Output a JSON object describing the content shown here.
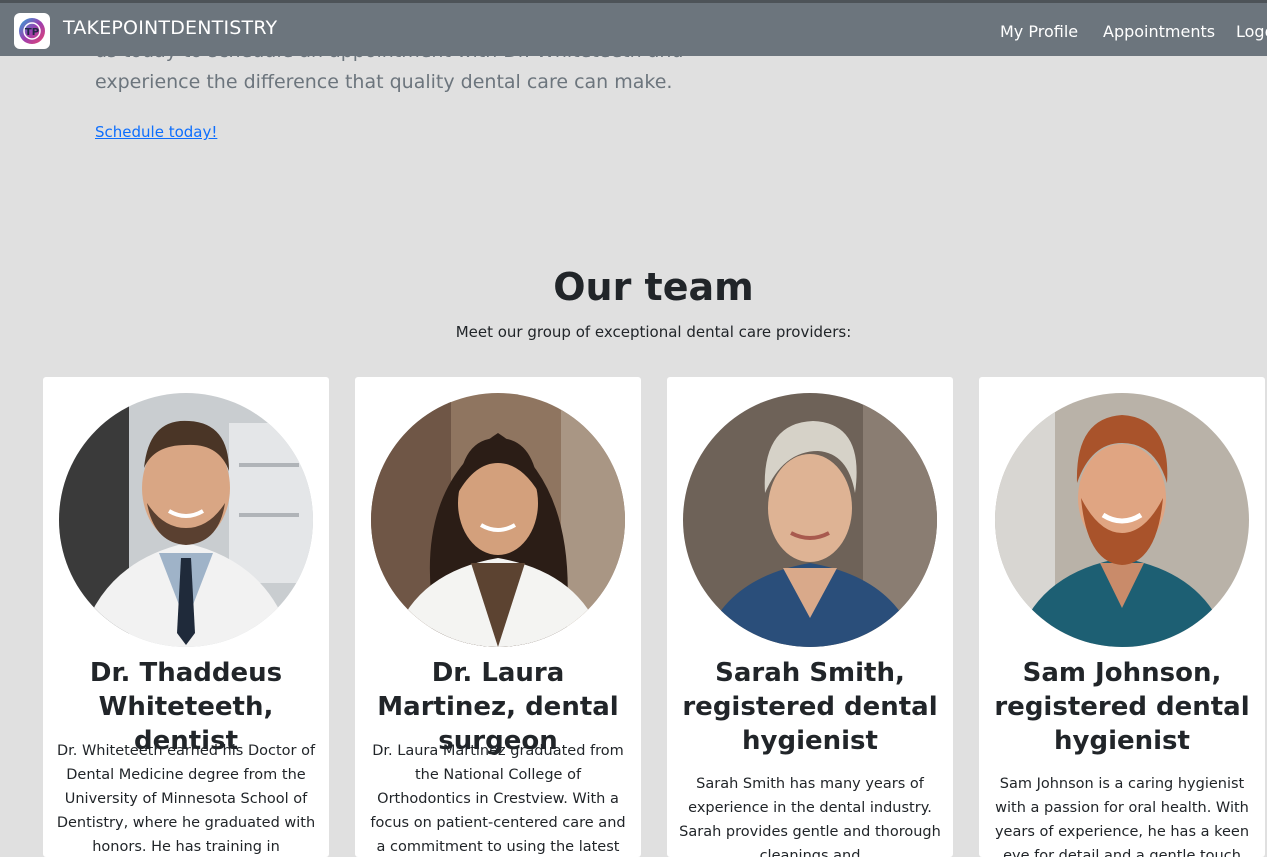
{
  "brand": {
    "name": "TAKEPOINTDENTISTRY",
    "logo_text": "TP"
  },
  "nav": {
    "my_profile": "My Profile",
    "appointments": "Appointments",
    "logout": "Logo"
  },
  "hero": {
    "line1": "us today to schedule an appointment with Dr. Whiteteeth and",
    "line2": "experience the difference that quality dental care can make.",
    "schedule_link": "Schedule today!"
  },
  "team": {
    "title": "Our team",
    "subtitle": "Meet our group of exceptional dental care providers:",
    "members": [
      {
        "name": "Dr. Thaddeus Whiteteeth, dentist",
        "bio": "Dr. Whiteteeth earned his Doctor of Dental Medicine degree from the University of Minnesota School of Dentistry, where he graduated with honors. He has training in advanced"
      },
      {
        "name": "Dr. Laura Martinez, dental surgeon",
        "bio": "Dr. Laura Martinez graduated from the National College of Orthodontics in Crestview. With a focus on patient-centered care and a commitment to using the latest"
      },
      {
        "name": "Sarah Smith, registered dental hygienist",
        "bio": "Sarah Smith has many years of experience in the dental industry. Sarah provides gentle and thorough cleanings and"
      },
      {
        "name": "Sam Johnson, registered dental hygienist",
        "bio": "Sam Johnson is a caring hygienist with a passion for oral health. With years of experience, he has a keen eye for detail and a gentle touch"
      }
    ]
  },
  "colors": {
    "navbar": "#6c757d",
    "page_bg": "#e0e0e0",
    "link": "#0d6efd",
    "card_bg": "#ffffff"
  }
}
